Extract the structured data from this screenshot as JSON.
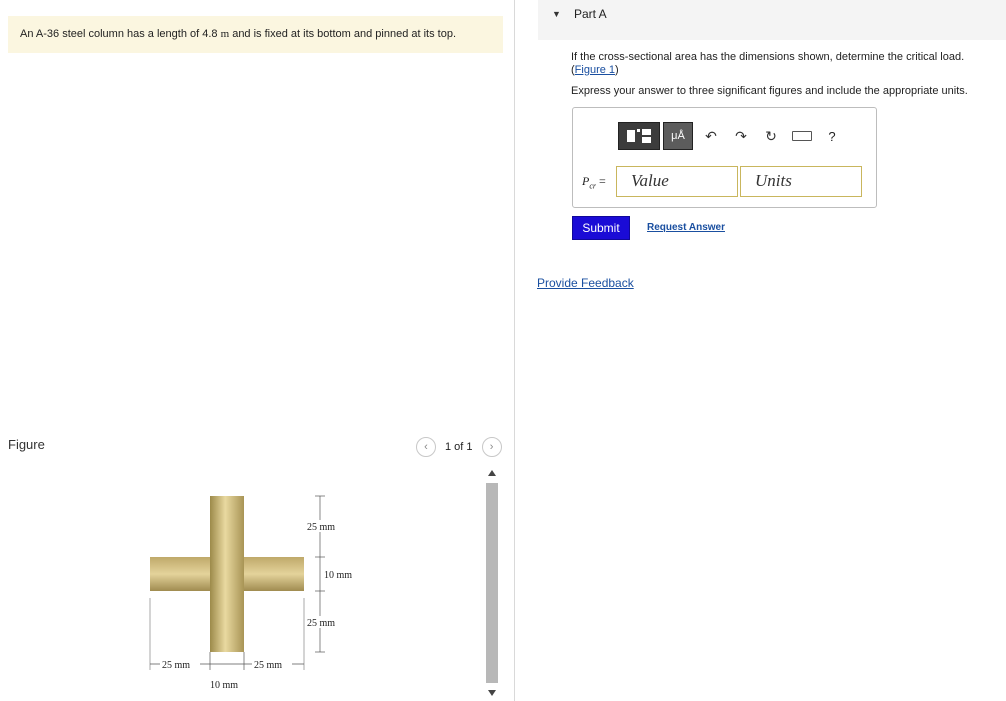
{
  "problem": {
    "statement_pre": "An A-36 steel column has a length of 4.8 ",
    "statement_unit": "m",
    "statement_post": " and is fixed at its bottom and pinned at its top."
  },
  "figure_panel": {
    "label": "Figure",
    "pager_text": "1 of 1",
    "prev_glyph": "‹",
    "next_glyph": "›",
    "dims": {
      "top": "25 mm",
      "mid": "10 mm",
      "bottom": "25 mm",
      "left": "25 mm",
      "right": "25 mm",
      "web": "10 mm"
    }
  },
  "part": {
    "caret": "▼",
    "title": "Part A",
    "question": "If the cross-sectional area has the dimensions shown, determine the critical load.",
    "figure_link_open": "(",
    "figure_link": "Figure 1",
    "figure_link_close": ")",
    "express": "Express your answer to three significant figures and include the appropriate units."
  },
  "toolbar": {
    "mu_label": "μÅ",
    "undo_glyph": "↶",
    "redo_glyph": "↷",
    "reset_glyph": "↻",
    "help_glyph": "?"
  },
  "answer": {
    "label_main": "P",
    "label_sub": "cr",
    "label_eq": " =",
    "value_placeholder": "Value",
    "units_placeholder": "Units"
  },
  "actions": {
    "submit": "Submit",
    "request_answer": "Request Answer",
    "provide_feedback": "Provide Feedback"
  }
}
